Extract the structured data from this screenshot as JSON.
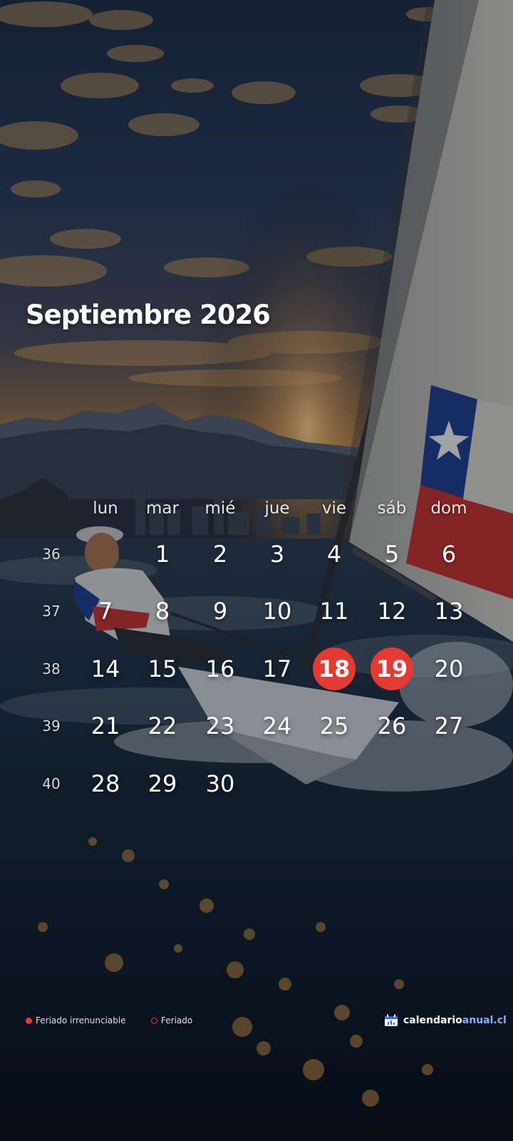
{
  "calendar": {
    "title": "Septiembre 2026",
    "day_names": [
      "lun",
      "mar",
      "mié",
      "jue",
      "vie",
      "sáb",
      "dom"
    ],
    "weeks": [
      {
        "number": "36",
        "days": [
          "",
          "1",
          "2",
          "3",
          "4",
          "5",
          "6"
        ]
      },
      {
        "number": "37",
        "days": [
          "7",
          "8",
          "9",
          "10",
          "11",
          "12",
          "13"
        ]
      },
      {
        "number": "38",
        "days": [
          "14",
          "15",
          "16",
          "17",
          "18",
          "19",
          "20"
        ]
      },
      {
        "number": "39",
        "days": [
          "21",
          "22",
          "23",
          "24",
          "25",
          "26",
          "27"
        ]
      },
      {
        "number": "40",
        "days": [
          "28",
          "29",
          "30",
          "",
          "",
          "",
          ""
        ]
      }
    ],
    "holidays_irrenunciable": [
      "18",
      "19"
    ],
    "holidays": []
  },
  "legend": {
    "irrenunciable": "Feriado irrenunciable",
    "feriado": "Feriado"
  },
  "brand": {
    "part1": "calendario",
    "part2": "anual.cl",
    "icon": "calendar-logo-icon"
  },
  "colors": {
    "holiday_irrenunciable": "#e43a33",
    "brand_accent": "#7fb2ff"
  },
  "background": {
    "description_icon": "sailboat-sunset-background"
  }
}
